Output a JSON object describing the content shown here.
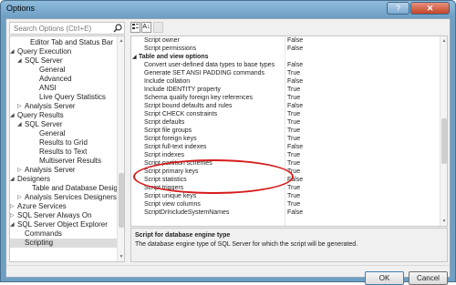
{
  "window": {
    "title": "Options",
    "help_label": "?",
    "close_label": "✕"
  },
  "search": {
    "placeholder": "Search Options (Ctrl+E)"
  },
  "tree": {
    "items": [
      {
        "label": "Editor Tab and Status Bar",
        "expander": ""
      },
      {
        "label": "Query Execution",
        "expander": "◢"
      },
      {
        "label": "SQL Server",
        "expander": "◢"
      },
      {
        "label": "General",
        "expander": ""
      },
      {
        "label": "Advanced",
        "expander": ""
      },
      {
        "label": "ANSI",
        "expander": ""
      },
      {
        "label": "Live Query Statistics",
        "expander": ""
      },
      {
        "label": "Analysis Server",
        "expander": "▷"
      },
      {
        "label": "Query Results",
        "expander": "◢"
      },
      {
        "label": "SQL Server",
        "expander": "◢"
      },
      {
        "label": "General",
        "expander": ""
      },
      {
        "label": "Results to Grid",
        "expander": ""
      },
      {
        "label": "Results to Text",
        "expander": ""
      },
      {
        "label": "Multiserver Results",
        "expander": ""
      },
      {
        "label": "Analysis Server",
        "expander": "▷"
      },
      {
        "label": "Designers",
        "expander": "◢"
      },
      {
        "label": "Table and Database Designers",
        "expander": ""
      },
      {
        "label": "Analysis Services Designers",
        "expander": "▷"
      },
      {
        "label": "Azure Services",
        "expander": "▷"
      },
      {
        "label": "SQL Server Always On",
        "expander": "▷"
      },
      {
        "label": "SQL Server Object Explorer",
        "expander": "◢"
      },
      {
        "label": "Commands",
        "expander": ""
      },
      {
        "label": "Scripting",
        "expander": ""
      }
    ]
  },
  "toolbar": {
    "categorized_icon": "categorized-icon",
    "alphabetical_label": "A↓",
    "pages_icon": "property-pages-icon"
  },
  "grid": {
    "rows": [
      {
        "name": "Script owner",
        "value": "False",
        "category": false
      },
      {
        "name": "Script permissions",
        "value": "False",
        "category": false
      },
      {
        "name": "Table and view options",
        "value": "",
        "category": true,
        "expander": "◢"
      },
      {
        "name": "Convert user-defined data types to base types",
        "value": "False",
        "category": false
      },
      {
        "name": "Generate SET ANSI PADDING commands",
        "value": "True",
        "category": false
      },
      {
        "name": "Include collation",
        "value": "False",
        "category": false
      },
      {
        "name": "Include IDENTITY property",
        "value": "True",
        "category": false
      },
      {
        "name": "Schema qualify foreign key references",
        "value": "True",
        "category": false
      },
      {
        "name": "Script bound defaults and rules",
        "value": "False",
        "category": false
      },
      {
        "name": "Script CHECK constraints",
        "value": "True",
        "category": false
      },
      {
        "name": "Script defaults",
        "value": "True",
        "category": false
      },
      {
        "name": "Script file groups",
        "value": "True",
        "category": false
      },
      {
        "name": "Script foreign keys",
        "value": "True",
        "category": false
      },
      {
        "name": "Script full-text indexes",
        "value": "False",
        "category": false
      },
      {
        "name": "Script indexes",
        "value": "True",
        "category": false
      },
      {
        "name": "Script partition schemes",
        "value": "True",
        "category": false
      },
      {
        "name": "Script primary keys",
        "value": "True",
        "category": false
      },
      {
        "name": "Script statistics",
        "value": "False",
        "category": false
      },
      {
        "name": "Script triggers",
        "value": "True",
        "category": false
      },
      {
        "name": "Script unique keys",
        "value": "True",
        "category": false
      },
      {
        "name": "Script view columns",
        "value": "True",
        "category": false
      },
      {
        "name": "ScriptDrIncludeSystemNames",
        "value": "False",
        "category": false
      }
    ]
  },
  "description": {
    "title": "Script for database engine type",
    "text": "The database engine type of SQL Server for which the script will be generated."
  },
  "buttons": {
    "ok": "OK",
    "cancel": "Cancel"
  },
  "colors": {
    "highlight_oval": "#d61a1a",
    "title_bar": "#6f9fc4",
    "close_button": "#c24527"
  }
}
